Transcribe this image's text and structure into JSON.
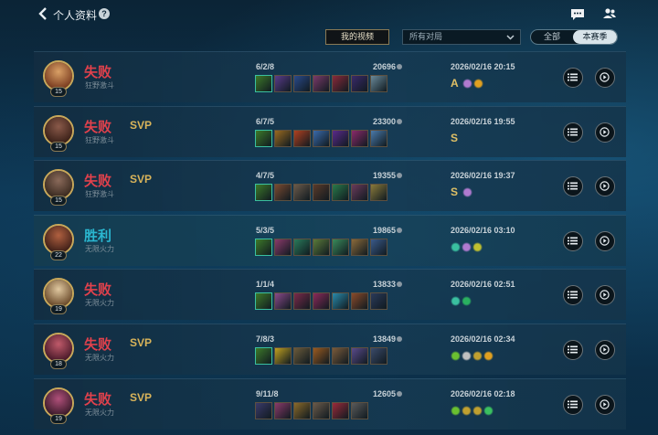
{
  "header": {
    "title": "个人资料",
    "help_icon": "help-icon",
    "chat_icon": "chat-icon",
    "friends_icon": "friends-icon"
  },
  "filters": {
    "my_videos_label": "我的视频",
    "mode_dropdown_value": "所有对局",
    "segment_all": "全部",
    "segment_season": "本赛季",
    "selected_segment": "本赛季"
  },
  "colors": {
    "lose": "#e0414c",
    "win": "#2ab6cf",
    "gold": "#d9b45a"
  },
  "matches": [
    {
      "level": "15",
      "result": "失败",
      "mode": "狂野激斗",
      "svp": "",
      "kda": "6/2/8",
      "gold": "20696",
      "date": "2026/02/16 20:15",
      "grade": "A",
      "avatar": [
        "#d9a066",
        "#7a3c20"
      ],
      "items": [
        "#3d7a2a",
        "#5a3c8a",
        "#2a4a8a",
        "#7a3a6a",
        "#8a2a3a",
        "#3a2a6a",
        "#6a8a9a"
      ],
      "badges": [
        "#b07acf",
        "#e0a020"
      ]
    },
    {
      "level": "15",
      "result": "失败",
      "mode": "狂野激斗",
      "svp": "SVP",
      "kda": "6/7/5",
      "gold": "23300",
      "date": "2026/02/16 19:55",
      "grade": "S",
      "avatar": [
        "#8a5a4a",
        "#3a2018"
      ],
      "items": [
        "#3d7a2a",
        "#9a6a20",
        "#b04020",
        "#3a6aaa",
        "#5a2a8a",
        "#8a2a6a",
        "#4a7aaa"
      ],
      "badges": []
    },
    {
      "level": "15",
      "result": "失败",
      "mode": "狂野激斗",
      "svp": "SVP",
      "kda": "4/7/5",
      "gold": "19355",
      "date": "2026/02/16 19:37",
      "grade": "S",
      "avatar": [
        "#8a6a5a",
        "#3a2a20"
      ],
      "items": [
        "#3d7a2a",
        "#7a4a30",
        "#6a5a4a",
        "#5a3a2a",
        "#2a7a4a",
        "#6a3a5a",
        "#8a7a3a"
      ],
      "badges": [
        "#b07acf"
      ]
    },
    {
      "level": "22",
      "result": "胜利",
      "mode": "无限火力",
      "svp": "",
      "kda": "5/3/5",
      "gold": "19865",
      "date": "2026/02/16 03:10",
      "grade": "",
      "avatar": [
        "#b06040",
        "#402018"
      ],
      "items": [
        "#3d7a2a",
        "#8a3a6a",
        "#2a7a5a",
        "#5a7a3a",
        "#3a8a5a",
        "#8a6a3a",
        "#3a5a8a"
      ],
      "badges": [
        "#3ac0a0",
        "#b07acf",
        "#c0c030"
      ]
    },
    {
      "level": "19",
      "result": "失败",
      "mode": "无限火力",
      "svp": "",
      "kda": "1/1/4",
      "gold": "13833",
      "date": "2026/02/16 02:51",
      "grade": "",
      "avatar": [
        "#e0c8a0",
        "#6a4a2a"
      ],
      "items": [
        "#3d7a2a",
        "#8a4a8a",
        "#7a2a4a",
        "#8a2a5a",
        "#2a8aaa",
        "#8a4a2a",
        "#2a3a5a"
      ],
      "badges": [
        "#3ac0a0",
        "#2ab060"
      ]
    },
    {
      "level": "18",
      "result": "失败",
      "mode": "无限火力",
      "svp": "SVP",
      "kda": "7/8/3",
      "gold": "13849",
      "date": "2026/02/16 02:34",
      "grade": "",
      "avatar": [
        "#c05a6a",
        "#4a1a2a"
      ],
      "items": [
        "#3d7a2a",
        "#c0a020",
        "#6a5a3a",
        "#9a5a20",
        "#7a5a3a",
        "#5a4a8a",
        "#3a4a6a"
      ],
      "badges": [
        "#6ac030",
        "#c0c0c0",
        "#c0a030",
        "#e0a020"
      ]
    },
    {
      "level": "19",
      "result": "失败",
      "mode": "无限火力",
      "svp": "SVP",
      "kda": "9/11/8",
      "gold": "12605",
      "date": "2026/02/16 02:18",
      "grade": "",
      "avatar": [
        "#b0507a",
        "#3a1a2a"
      ],
      "items": [
        "#3a3a6a",
        "#8a3a6a",
        "#8a6a2a",
        "#6a5a4a",
        "#9a2a3a",
        "#5a5a5a"
      ],
      "badges": [
        "#6ac030",
        "#c0a030",
        "#c0a030",
        "#3ac060"
      ]
    }
  ]
}
